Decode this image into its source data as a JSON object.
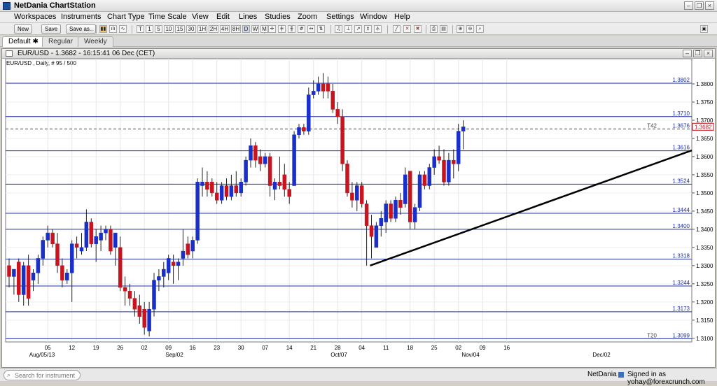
{
  "app": {
    "title": "NetDania ChartStation"
  },
  "menu": [
    "Workspaces",
    "Instruments",
    "Chart Type",
    "Time Scale",
    "View",
    "Edit",
    "Lines",
    "Studies",
    "Zoom",
    "Settings",
    "Window",
    "Help"
  ],
  "toolbar": {
    "new_label": "New",
    "save_label": "Save",
    "save_as_label": "Save as..",
    "timeframes": [
      "T",
      "1",
      "5",
      "10",
      "15",
      "30",
      "1H",
      "2H",
      "4H",
      "8H",
      "D",
      "W",
      "M"
    ]
  },
  "tabs": [
    "Default",
    "Regular",
    "Weekly"
  ],
  "chart_window": {
    "title": "EUR/USD - 1.3682 - 16:15:41  06 Dec (CET)",
    "subtitle": "EUR/USD , Daily, # 95 / 500"
  },
  "chart_data": {
    "type": "candlestick",
    "instrument": "EUR/USD",
    "ylim": [
      1.309,
      1.385
    ],
    "y_ticks": [
      "1.3100",
      "1.3150",
      "1.3200",
      "1.3250",
      "1.3300",
      "1.3350",
      "1.3400",
      "1.3450",
      "1.3500",
      "1.3550",
      "1.3600",
      "1.3650",
      "1.3700",
      "1.3750",
      "1.3800"
    ],
    "x_ticks": [
      "05",
      "12",
      "19",
      "26",
      "02",
      "09",
      "16",
      "23",
      "30",
      "07",
      "14",
      "21",
      "28",
      "04",
      "11",
      "18",
      "25",
      "02",
      "09",
      "16"
    ],
    "x_month_labels": [
      "Aug/05/13",
      "Sep/02",
      "Oct/07",
      "Nov/04",
      "Dec/02"
    ],
    "horizontal_lines": [
      "1.3802",
      "1.3710",
      "1.3676",
      "1.3616",
      "1.3524",
      "1.3444",
      "1.3400",
      "1.3318",
      "1.3244",
      "1.3173",
      "1.3099"
    ],
    "dashed_line_label": "T42",
    "bottom_line_label": "T20",
    "current_price": "1.3682",
    "trend_line": {
      "from": [
        "Nov 08",
        1.33
      ],
      "to": [
        "Dec 13",
        1.3617
      ]
    },
    "candles": [
      {
        "o": 1.33,
        "h": 1.332,
        "l": 1.324,
        "c": 1.327
      },
      {
        "o": 1.327,
        "h": 1.329,
        "l": 1.322,
        "c": 1.329
      },
      {
        "o": 1.331,
        "h": 1.332,
        "l": 1.32,
        "c": 1.322
      },
      {
        "o": 1.322,
        "h": 1.331,
        "l": 1.319,
        "c": 1.33
      },
      {
        "o": 1.33,
        "h": 1.333,
        "l": 1.319,
        "c": 1.321
      },
      {
        "o": 1.326,
        "h": 1.329,
        "l": 1.323,
        "c": 1.328
      },
      {
        "o": 1.328,
        "h": 1.333,
        "l": 1.325,
        "c": 1.332
      },
      {
        "o": 1.332,
        "h": 1.338,
        "l": 1.33,
        "c": 1.337
      },
      {
        "o": 1.337,
        "h": 1.341,
        "l": 1.335,
        "c": 1.339
      },
      {
        "o": 1.339,
        "h": 1.34,
        "l": 1.335,
        "c": 1.336
      },
      {
        "o": 1.336,
        "h": 1.339,
        "l": 1.328,
        "c": 1.33
      },
      {
        "o": 1.33,
        "h": 1.332,
        "l": 1.324,
        "c": 1.326
      },
      {
        "o": 1.326,
        "h": 1.329,
        "l": 1.325,
        "c": 1.328
      },
      {
        "o": 1.328,
        "h": 1.337,
        "l": 1.32,
        "c": 1.336
      },
      {
        "o": 1.336,
        "h": 1.338,
        "l": 1.332,
        "c": 1.335
      },
      {
        "o": 1.334,
        "h": 1.339,
        "l": 1.333,
        "c": 1.335
      },
      {
        "o": 1.335,
        "h": 1.3455,
        "l": 1.334,
        "c": 1.342
      },
      {
        "o": 1.342,
        "h": 1.343,
        "l": 1.335,
        "c": 1.336
      },
      {
        "o": 1.336,
        "h": 1.34,
        "l": 1.331,
        "c": 1.338
      },
      {
        "o": 1.337,
        "h": 1.341,
        "l": 1.334,
        "c": 1.339
      },
      {
        "o": 1.339,
        "h": 1.341,
        "l": 1.337,
        "c": 1.34
      },
      {
        "o": 1.34,
        "h": 1.341,
        "l": 1.333,
        "c": 1.334
      },
      {
        "o": 1.335,
        "h": 1.339,
        "l": 1.33,
        "c": 1.339
      },
      {
        "o": 1.335,
        "h": 1.338,
        "l": 1.323,
        "c": 1.324
      },
      {
        "o": 1.324,
        "h": 1.327,
        "l": 1.319,
        "c": 1.323
      },
      {
        "o": 1.323,
        "h": 1.325,
        "l": 1.319,
        "c": 1.321
      },
      {
        "o": 1.321,
        "h": 1.323,
        "l": 1.316,
        "c": 1.318
      },
      {
        "o": 1.319,
        "h": 1.322,
        "l": 1.314,
        "c": 1.316
      },
      {
        "o": 1.318,
        "h": 1.32,
        "l": 1.311,
        "c": 1.313
      },
      {
        "o": 1.312,
        "h": 1.32,
        "l": 1.3105,
        "c": 1.318
      },
      {
        "o": 1.318,
        "h": 1.328,
        "l": 1.316,
        "c": 1.326
      },
      {
        "o": 1.326,
        "h": 1.329,
        "l": 1.323,
        "c": 1.327
      },
      {
        "o": 1.327,
        "h": 1.331,
        "l": 1.324,
        "c": 1.329
      },
      {
        "o": 1.328,
        "h": 1.333,
        "l": 1.326,
        "c": 1.332
      },
      {
        "o": 1.331,
        "h": 1.333,
        "l": 1.325,
        "c": 1.33
      },
      {
        "o": 1.33,
        "h": 1.332,
        "l": 1.326,
        "c": 1.331
      },
      {
        "o": 1.332,
        "h": 1.34,
        "l": 1.33,
        "c": 1.334
      },
      {
        "o": 1.336,
        "h": 1.338,
        "l": 1.332,
        "c": 1.333
      },
      {
        "o": 1.334,
        "h": 1.338,
        "l": 1.332,
        "c": 1.337
      },
      {
        "o": 1.337,
        "h": 1.354,
        "l": 1.336,
        "c": 1.353
      },
      {
        "o": 1.352,
        "h": 1.357,
        "l": 1.349,
        "c": 1.353
      },
      {
        "o": 1.353,
        "h": 1.356,
        "l": 1.349,
        "c": 1.351
      },
      {
        "o": 1.353,
        "h": 1.354,
        "l": 1.349,
        "c": 1.35
      },
      {
        "o": 1.35,
        "h": 1.353,
        "l": 1.347,
        "c": 1.348
      },
      {
        "o": 1.348,
        "h": 1.353,
        "l": 1.347,
        "c": 1.352
      },
      {
        "o": 1.352,
        "h": 1.354,
        "l": 1.348,
        "c": 1.349
      },
      {
        "o": 1.349,
        "h": 1.355,
        "l": 1.348,
        "c": 1.352
      },
      {
        "o": 1.352,
        "h": 1.356,
        "l": 1.349,
        "c": 1.35
      },
      {
        "o": 1.35,
        "h": 1.354,
        "l": 1.349,
        "c": 1.353
      },
      {
        "o": 1.353,
        "h": 1.36,
        "l": 1.352,
        "c": 1.359
      },
      {
        "o": 1.359,
        "h": 1.365,
        "l": 1.357,
        "c": 1.363
      },
      {
        "o": 1.363,
        "h": 1.364,
        "l": 1.357,
        "c": 1.359
      },
      {
        "o": 1.36,
        "h": 1.362,
        "l": 1.356,
        "c": 1.358
      },
      {
        "o": 1.358,
        "h": 1.361,
        "l": 1.357,
        "c": 1.36
      },
      {
        "o": 1.36,
        "h": 1.361,
        "l": 1.349,
        "c": 1.352
      },
      {
        "o": 1.351,
        "h": 1.354,
        "l": 1.348,
        "c": 1.353
      },
      {
        "o": 1.353,
        "h": 1.36,
        "l": 1.351,
        "c": 1.352
      },
      {
        "o": 1.355,
        "h": 1.358,
        "l": 1.349,
        "c": 1.351
      },
      {
        "o": 1.351,
        "h": 1.353,
        "l": 1.347,
        "c": 1.349
      },
      {
        "o": 1.352,
        "h": 1.367,
        "l": 1.352,
        "c": 1.366
      },
      {
        "o": 1.366,
        "h": 1.369,
        "l": 1.365,
        "c": 1.368
      },
      {
        "o": 1.368,
        "h": 1.369,
        "l": 1.366,
        "c": 1.367
      },
      {
        "o": 1.367,
        "h": 1.379,
        "l": 1.366,
        "c": 1.377
      },
      {
        "o": 1.377,
        "h": 1.381,
        "l": 1.376,
        "c": 1.378
      },
      {
        "o": 1.378,
        "h": 1.382,
        "l": 1.377,
        "c": 1.38
      },
      {
        "o": 1.38,
        "h": 1.383,
        "l": 1.376,
        "c": 1.378
      },
      {
        "o": 1.38,
        "h": 1.382,
        "l": 1.376,
        "c": 1.378
      },
      {
        "o": 1.378,
        "h": 1.38,
        "l": 1.372,
        "c": 1.373
      },
      {
        "o": 1.373,
        "h": 1.375,
        "l": 1.369,
        "c": 1.371
      },
      {
        "o": 1.371,
        "h": 1.373,
        "l": 1.356,
        "c": 1.358
      },
      {
        "o": 1.358,
        "h": 1.359,
        "l": 1.349,
        "c": 1.35
      },
      {
        "o": 1.35,
        "h": 1.353,
        "l": 1.346,
        "c": 1.348
      },
      {
        "o": 1.348,
        "h": 1.353,
        "l": 1.345,
        "c": 1.352
      },
      {
        "o": 1.352,
        "h": 1.353,
        "l": 1.346,
        "c": 1.347
      },
      {
        "o": 1.347,
        "h": 1.348,
        "l": 1.33,
        "c": 1.341
      },
      {
        "o": 1.341,
        "h": 1.344,
        "l": 1.332,
        "c": 1.338
      },
      {
        "o": 1.335,
        "h": 1.342,
        "l": 1.335,
        "c": 1.341
      },
      {
        "o": 1.341,
        "h": 1.345,
        "l": 1.338,
        "c": 1.343
      },
      {
        "o": 1.342,
        "h": 1.348,
        "l": 1.339,
        "c": 1.347
      },
      {
        "o": 1.347,
        "h": 1.348,
        "l": 1.342,
        "c": 1.343
      },
      {
        "o": 1.343,
        "h": 1.349,
        "l": 1.342,
        "c": 1.348
      },
      {
        "o": 1.348,
        "h": 1.35,
        "l": 1.344,
        "c": 1.346
      },
      {
        "o": 1.347,
        "h": 1.357,
        "l": 1.346,
        "c": 1.355
      },
      {
        "o": 1.356,
        "h": 1.356,
        "l": 1.34,
        "c": 1.342
      },
      {
        "o": 1.342,
        "h": 1.347,
        "l": 1.34,
        "c": 1.346
      },
      {
        "o": 1.346,
        "h": 1.356,
        "l": 1.345,
        "c": 1.355
      },
      {
        "o": 1.355,
        "h": 1.356,
        "l": 1.351,
        "c": 1.352
      },
      {
        "o": 1.352,
        "h": 1.358,
        "l": 1.351,
        "c": 1.357
      },
      {
        "o": 1.357,
        "h": 1.362,
        "l": 1.355,
        "c": 1.36
      },
      {
        "o": 1.36,
        "h": 1.363,
        "l": 1.358,
        "c": 1.359
      },
      {
        "o": 1.359,
        "h": 1.362,
        "l": 1.352,
        "c": 1.353
      },
      {
        "o": 1.353,
        "h": 1.361,
        "l": 1.352,
        "c": 1.359
      },
      {
        "o": 1.359,
        "h": 1.362,
        "l": 1.354,
        "c": 1.358
      },
      {
        "o": 1.358,
        "h": 1.369,
        "l": 1.356,
        "c": 1.367
      },
      {
        "o": 1.367,
        "h": 1.37,
        "l": 1.362,
        "c": 1.3682
      }
    ]
  },
  "status": {
    "search_placeholder": "Search for instrument",
    "brand": "NetDania",
    "signed_in": "Signed in as yohay@forexcrunch.com"
  }
}
